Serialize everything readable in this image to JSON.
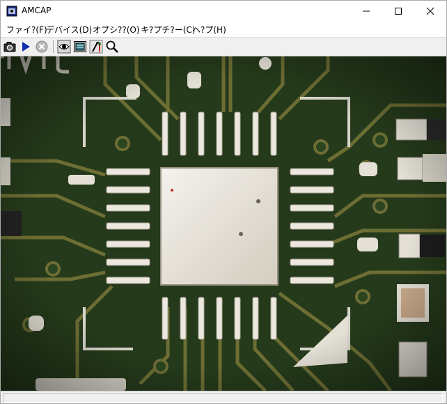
{
  "window": {
    "title": "AMCAP"
  },
  "menu": {
    "items": [
      {
        "id": "file",
        "label": "ファイ?(F)"
      },
      {
        "id": "devices",
        "label": "デバイス(D)"
      },
      {
        "id": "options",
        "label": "オプシ??(O)"
      },
      {
        "id": "capture",
        "label": "キ?プチ?ー(C)"
      },
      {
        "id": "help",
        "label": "ヘ?プ(H)"
      }
    ]
  },
  "toolbar": {
    "buttons": [
      {
        "id": "snapshot",
        "icon": "camera-icon"
      },
      {
        "id": "play",
        "icon": "play-icon"
      },
      {
        "id": "stop",
        "icon": "stop-icon"
      },
      {
        "id": "preview",
        "icon": "eye-icon"
      },
      {
        "id": "overlay",
        "icon": "monitor-icon"
      },
      {
        "id": "settings",
        "icon": "tools-icon"
      },
      {
        "id": "zoom",
        "icon": "magnifier-icon"
      }
    ]
  },
  "video": {
    "subject": "pcb-qfn-chip"
  },
  "colors": {
    "pcb": "#1f3318",
    "trace": "#7d7a3a",
    "pad": "#e2ddd2"
  },
  "status": {
    "text": ""
  }
}
